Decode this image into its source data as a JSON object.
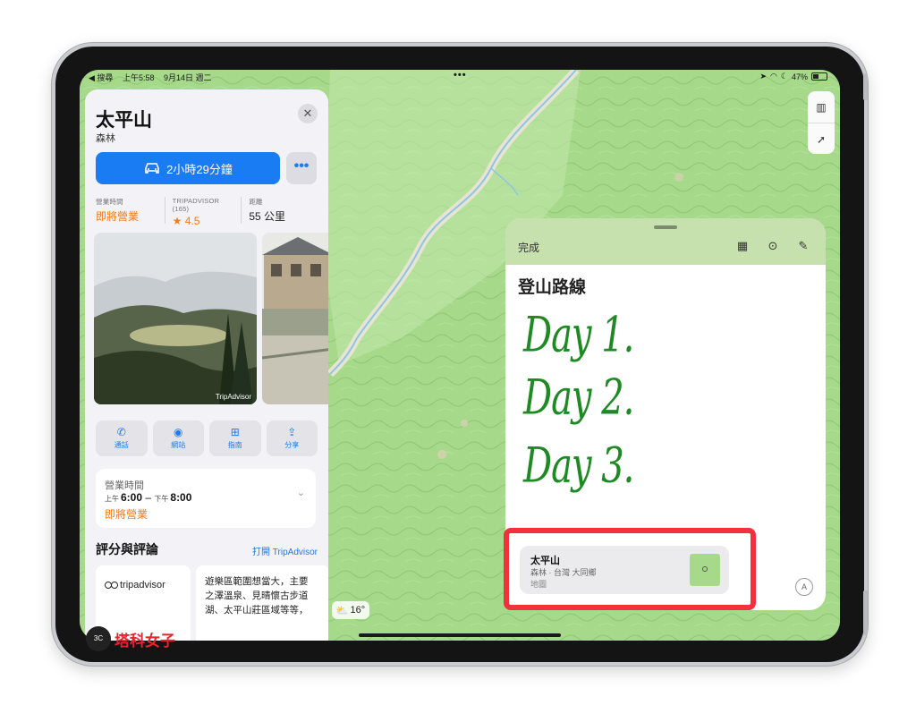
{
  "status_bar": {
    "back_app": "◀ 搜尋",
    "time": "上午5:58",
    "date": "9月14日 週二",
    "battery": "47%"
  },
  "place_card": {
    "title": "太平山",
    "subtitle": "森林",
    "close_icon": "close-icon",
    "directions_label": "2小時29分鐘",
    "more_label": "•••",
    "stats": [
      {
        "label": "營業時間",
        "value": "即將營業"
      },
      {
        "label": "TRIPADVISOR (165)",
        "value": "★ 4.5"
      },
      {
        "label": "距離",
        "value": "55 公里"
      }
    ],
    "photo_credit": "TripAdvisor",
    "actions": [
      {
        "label": "通話",
        "icon": "phone-icon"
      },
      {
        "label": "網站",
        "icon": "compass-icon"
      },
      {
        "label": "指南",
        "icon": "plus-icon"
      },
      {
        "label": "分享",
        "icon": "share-icon"
      }
    ],
    "hours": {
      "label": "營業時間",
      "open_prefix": "上午",
      "open_time": "6:00",
      "close_prefix": "下午",
      "close_time": "8:00",
      "status": "即將營業"
    },
    "reviews": {
      "title": "評分與評論",
      "link": "打開 TripAdvisor",
      "brand": "tripadvisor",
      "text": "遊樂區範圍想當大，主要\n之澤溫泉、見晴懷古步道\n湖、太平山莊區域等等，"
    }
  },
  "weather": {
    "temp": "16°",
    "icon": "partly-cloudy-icon"
  },
  "quick_note": {
    "done_label": "完成",
    "title": "登山路線",
    "lines": [
      "Day 1.",
      "Day 2.",
      "Day 3."
    ],
    "link": {
      "title": "太平山",
      "subtitle": "森林 · 台灣 大同鄉",
      "app": "地圖"
    }
  },
  "watermark": {
    "badge": "3C",
    "text": "塔科女子"
  },
  "colors": {
    "accent_blue": "#1a7cf2",
    "orange": "#f27c1a",
    "highlight_red": "#f2313d",
    "handwriting_green": "#1f8a24",
    "map_green": "#a6d98a"
  }
}
